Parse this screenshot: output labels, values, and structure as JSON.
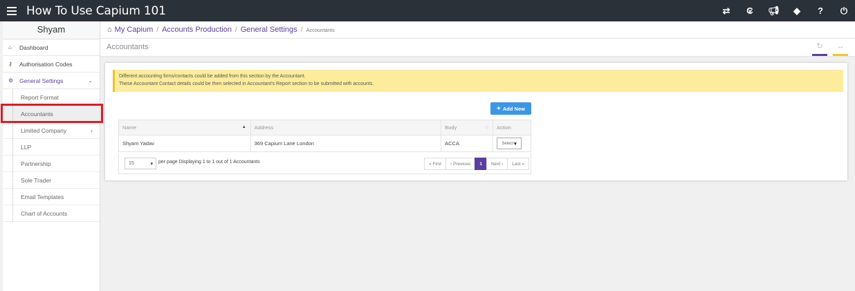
{
  "app": {
    "title": "How To Use Capium 101"
  },
  "topbar_icons": [
    "switch-icon",
    "currency-icon",
    "megaphone-icon",
    "tag-icon",
    "help-icon",
    "power-icon"
  ],
  "sidebar": {
    "user": "Shyam",
    "items": [
      {
        "label": "Dashboard",
        "icon": "home-icon"
      },
      {
        "label": "Authorisation Codes",
        "icon": "key-icon"
      },
      {
        "label": "General Settings",
        "icon": "gears-icon"
      }
    ],
    "sub_items": [
      {
        "label": "Report Format"
      },
      {
        "label": "Accountants"
      },
      {
        "label": "Limited Company"
      },
      {
        "label": "LLP"
      },
      {
        "label": "Partnership"
      },
      {
        "label": "Sole Trader"
      },
      {
        "label": "Email Templates"
      },
      {
        "label": "Chart of Accounts"
      }
    ]
  },
  "breadcrumb": {
    "items": [
      "My Capium",
      "Accounts Production",
      "General Settings"
    ],
    "current": "Accountants"
  },
  "page": {
    "title": "Accountants"
  },
  "alert": {
    "line1": "Different accounting firms/contacts could be added from this section by the Accountant.",
    "line2": "These Accountant Contact details could be then selected in Accountant's Report section to be submitted with accounts."
  },
  "add_button": "Add New",
  "table": {
    "columns": [
      "Name",
      "Address",
      "Body",
      "Action"
    ],
    "rows": [
      {
        "name": "Shyam Yadav",
        "address": "369 Capium Lane London",
        "body": "ACCA",
        "action": "Select"
      }
    ]
  },
  "pagination": {
    "per_page": "15",
    "per_page_label": "per page",
    "summary": "Displaying 1 to 1 out of 1 Accountants",
    "first": "« First",
    "previous": "‹ Previous",
    "current": "1",
    "next": "Next ›",
    "last": "Last »"
  },
  "colors": {
    "accent": "#5b3fa0",
    "button": "#3d95e6",
    "alert_bg": "#fcec9b",
    "highlight": "#e01b24"
  }
}
